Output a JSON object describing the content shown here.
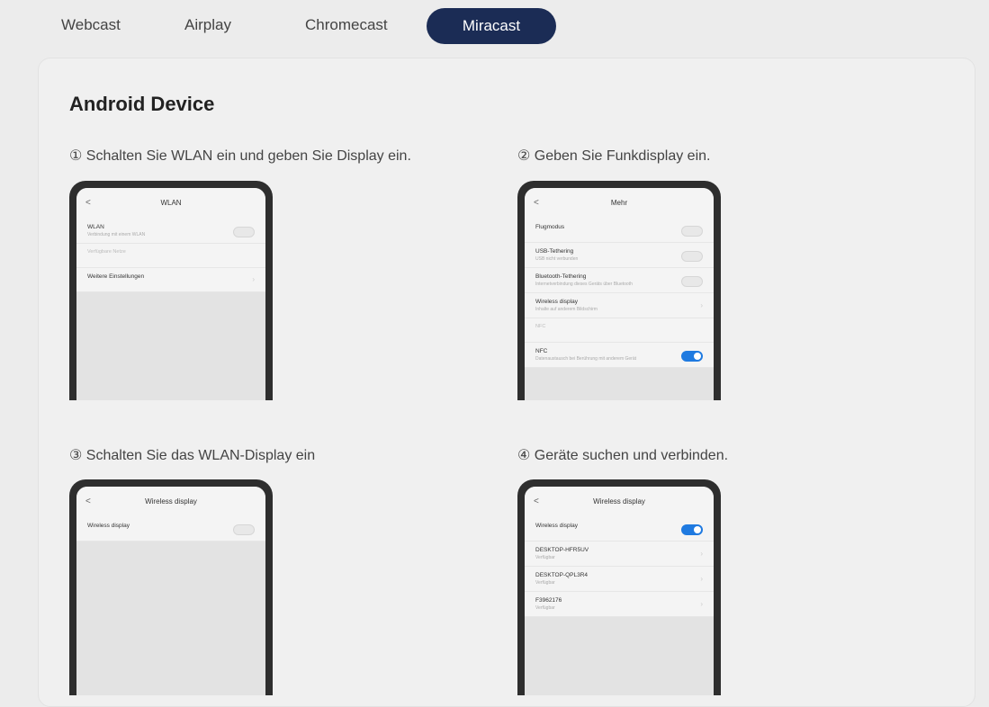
{
  "tabs": [
    "Webcast",
    "Airplay",
    "Chromecast",
    "Miracast"
  ],
  "active_tab": "Miracast",
  "section_title": "Android Device",
  "steps": [
    {
      "label": "① Schalten Sie WLAN ein und geben Sie Display ein.",
      "screen": {
        "title": "WLAN",
        "rows": [
          {
            "label": "WLAN",
            "sub": "Verbindung mit einem WLAN",
            "control": "toggle-off"
          },
          {
            "label": "Verfügbare Netze",
            "sub": "",
            "control": "section"
          },
          {
            "label": "Weitere Einstellungen",
            "sub": "",
            "control": "chevron"
          }
        ]
      }
    },
    {
      "label": "② Geben Sie Funkdisplay ein.",
      "screen": {
        "title": "Mehr",
        "rows": [
          {
            "label": "Flugmodus",
            "sub": "",
            "control": "toggle-off"
          },
          {
            "label": "USB-Tethering",
            "sub": "USB nicht verbunden",
            "control": "toggle-off"
          },
          {
            "label": "Bluetooth-Tethering",
            "sub": "Internetverbindung dieses Geräts über Bluetooth",
            "control": "toggle-off"
          },
          {
            "label": "Wireless display",
            "sub": "Inhalte auf anderem Bildschirm",
            "control": "chevron"
          },
          {
            "label": "NFC",
            "sub": "",
            "control": "section"
          },
          {
            "label": "NFC",
            "sub": "Datenaustausch bei Berührung mit anderem Gerät",
            "control": "toggle-on"
          }
        ]
      }
    },
    {
      "label": "③ Schalten Sie das WLAN-Display ein",
      "screen": {
        "title": "Wireless display",
        "rows": [
          {
            "label": "Wireless display",
            "sub": "",
            "control": "toggle-off"
          }
        ]
      }
    },
    {
      "label": "④ Geräte suchen und verbinden.",
      "screen": {
        "title": "Wireless display",
        "rows": [
          {
            "label": "Wireless display",
            "sub": "",
            "control": "toggle-on"
          },
          {
            "label": "DESKTOP-HFR5UV",
            "sub": "Verfügbar",
            "control": "chevron"
          },
          {
            "label": "DESKTOP-QPL3R4",
            "sub": "Verfügbar",
            "control": "chevron"
          },
          {
            "label": "F3962176",
            "sub": "Verfügbar",
            "control": "chevron"
          }
        ]
      }
    }
  ],
  "colors": {
    "active_tab": "#1b2c55",
    "toggle_on": "#1f7ae0"
  }
}
